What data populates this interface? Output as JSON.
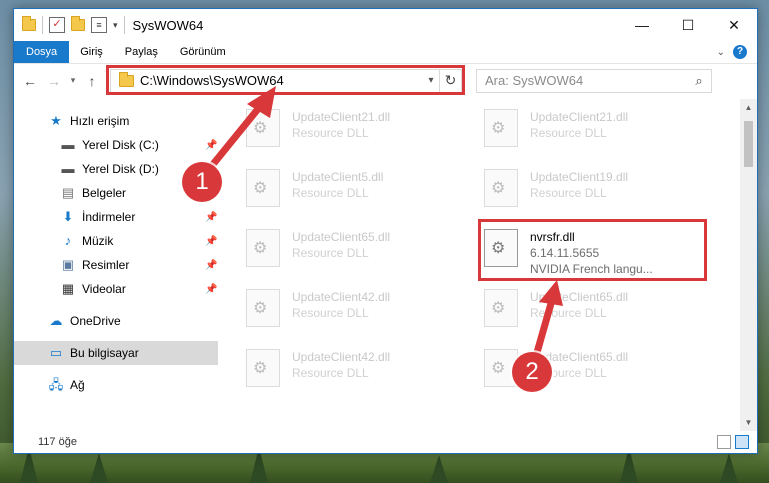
{
  "window": {
    "title": "SysWOW64",
    "controls": {
      "minimize": "—",
      "maximize": "☐",
      "close": "✕"
    }
  },
  "ribbon": {
    "tabs": [
      {
        "label": "Dosya",
        "active": true
      },
      {
        "label": "Giriş"
      },
      {
        "label": "Paylaş"
      },
      {
        "label": "Görünüm"
      }
    ],
    "help": "?"
  },
  "address": {
    "path": "C:\\Windows\\SysWOW64",
    "search_placeholder": "Ara: SysWOW64"
  },
  "nav": {
    "quick_access": "Hızlı erişim",
    "items": [
      {
        "label": "Yerel Disk (C:)",
        "icon": "drive-icon",
        "pinned": true
      },
      {
        "label": "Yerel Disk (D:)",
        "icon": "drive-icon",
        "pinned": false
      },
      {
        "label": "Belgeler",
        "icon": "documents-icon",
        "pinned": true
      },
      {
        "label": "İndirmeler",
        "icon": "download-icon",
        "pinned": true
      },
      {
        "label": "Müzik",
        "icon": "music-icon",
        "pinned": true
      },
      {
        "label": "Resimler",
        "icon": "pictures-icon",
        "pinned": true
      },
      {
        "label": "Videolar",
        "icon": "videos-icon",
        "pinned": true
      }
    ],
    "onedrive": "OneDrive",
    "this_pc": "Bu bilgisayar",
    "network": "Ağ"
  },
  "files": [
    {
      "name": "UpdateClient21.dll",
      "desc": "Resource DLL"
    },
    {
      "name": "UpdateClient21.dll",
      "desc": "Resource DLL"
    },
    {
      "name": "UpdateClient5.dll",
      "desc": "Resource DLL"
    },
    {
      "name": "UpdateClient19.dll",
      "desc": "Resource DLL"
    },
    {
      "name": "UpdateClient65.dll",
      "desc": "Resource DLL"
    },
    {
      "name": "nvrsfr.dll",
      "desc": "6.14.11.5655",
      "desc2": "NVIDIA French langu...",
      "active": true
    },
    {
      "name": "UpdateClient42.dll",
      "desc": "Resource DLL"
    },
    {
      "name": "UpdateClient65.dll",
      "desc": "Resource DLL"
    },
    {
      "name": "UpdateClient42.dll",
      "desc": "Resource DLL"
    },
    {
      "name": "UpdateClient65.dll",
      "desc": "Resource DLL"
    }
  ],
  "status": {
    "count": "117 öğe"
  },
  "annotations": {
    "step1": "1",
    "step2": "2",
    "color": "#d9383a"
  },
  "colors": {
    "accent": "#1979ca",
    "highlight": "#d9383a"
  }
}
